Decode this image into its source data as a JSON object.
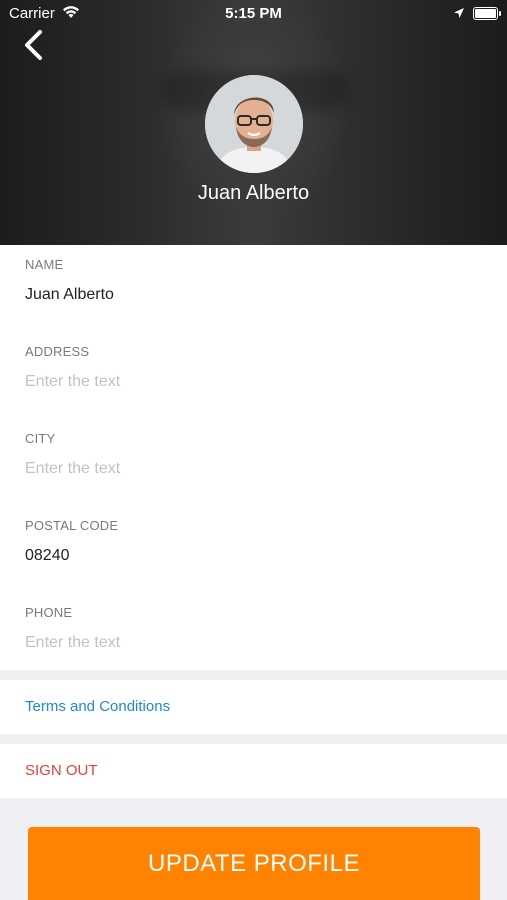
{
  "status_bar": {
    "carrier": "Carrier",
    "time": "5:15 PM",
    "wifi_icon": "wifi-icon",
    "location_icon": "location-arrow-icon",
    "battery_icon": "battery-icon"
  },
  "header": {
    "back_icon": "chevron-left-icon",
    "name": "Juan Alberto"
  },
  "form": {
    "fields": [
      {
        "label": "NAME",
        "value": "Juan Alberto",
        "placeholder": "Enter the text"
      },
      {
        "label": "ADDRESS",
        "value": "",
        "placeholder": "Enter the text"
      },
      {
        "label": "CITY",
        "value": "",
        "placeholder": "Enter the text"
      },
      {
        "label": "POSTAL CODE",
        "value": "08240",
        "placeholder": "Enter the text"
      },
      {
        "label": "PHONE",
        "value": "",
        "placeholder": "Enter the text"
      }
    ]
  },
  "links": {
    "terms": "Terms and Conditions",
    "sign_out": "SIGN OUT"
  },
  "actions": {
    "update_profile": "UPDATE PROFILE"
  },
  "colors": {
    "accent": "#ff8300",
    "link": "#1e88d8",
    "danger": "#e8403a",
    "background": "#efeff4"
  }
}
